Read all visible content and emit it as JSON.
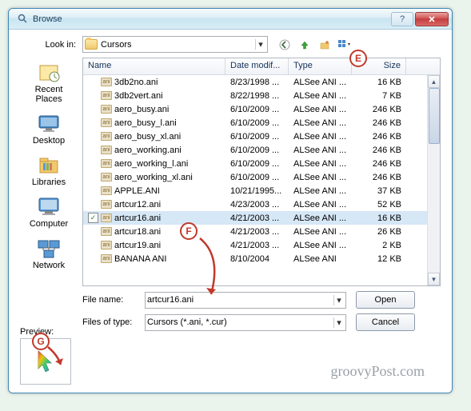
{
  "window": {
    "title": "Browse"
  },
  "lookin": {
    "label": "Look in:",
    "value": "Cursors"
  },
  "toolbar_icons": [
    "back",
    "up",
    "new-folder",
    "view"
  ],
  "columns": {
    "name": "Name",
    "date": "Date modif...",
    "type": "Type",
    "size": "Size"
  },
  "files": [
    {
      "name": "3db2no.ani",
      "date": "8/23/1998 ...",
      "type": "ALSee ANI ...",
      "size": "16 KB",
      "sel": false
    },
    {
      "name": "3db2vert.ani",
      "date": "8/22/1998 ...",
      "type": "ALSee ANI ...",
      "size": "7 KB",
      "sel": false
    },
    {
      "name": "aero_busy.ani",
      "date": "6/10/2009 ...",
      "type": "ALSee ANI ...",
      "size": "246 KB",
      "sel": false
    },
    {
      "name": "aero_busy_l.ani",
      "date": "6/10/2009 ...",
      "type": "ALSee ANI ...",
      "size": "246 KB",
      "sel": false
    },
    {
      "name": "aero_busy_xl.ani",
      "date": "6/10/2009 ...",
      "type": "ALSee ANI ...",
      "size": "246 KB",
      "sel": false
    },
    {
      "name": "aero_working.ani",
      "date": "6/10/2009 ...",
      "type": "ALSee ANI ...",
      "size": "246 KB",
      "sel": false
    },
    {
      "name": "aero_working_l.ani",
      "date": "6/10/2009 ...",
      "type": "ALSee ANI ...",
      "size": "246 KB",
      "sel": false
    },
    {
      "name": "aero_working_xl.ani",
      "date": "6/10/2009 ...",
      "type": "ALSee ANI ...",
      "size": "246 KB",
      "sel": false
    },
    {
      "name": "APPLE.ANI",
      "date": "10/21/1995...",
      "type": "ALSee ANI ...",
      "size": "37 KB",
      "sel": false
    },
    {
      "name": "artcur12.ani",
      "date": "4/23/2003 ...",
      "type": "ALSee ANI ...",
      "size": "52 KB",
      "sel": false
    },
    {
      "name": "artcur16.ani",
      "date": "4/21/2003 ...",
      "type": "ALSee ANI ...",
      "size": "16 KB",
      "sel": true
    },
    {
      "name": "artcur18.ani",
      "date": "4/21/2003 ...",
      "type": "ALSee ANI ...",
      "size": "26 KB",
      "sel": false
    },
    {
      "name": "artcur19.ani",
      "date": "4/21/2003 ...",
      "type": "ALSee ANI ...",
      "size": "2 KB",
      "sel": false
    },
    {
      "name": "BANANA ANI",
      "date": "8/10/2004",
      "type": "ALSee ANI",
      "size": "12 KB",
      "sel": false
    }
  ],
  "places": [
    {
      "label": "Recent Places",
      "kind": "recent"
    },
    {
      "label": "Desktop",
      "kind": "desktop"
    },
    {
      "label": "Libraries",
      "kind": "libraries"
    },
    {
      "label": "Computer",
      "kind": "computer"
    },
    {
      "label": "Network",
      "kind": "network"
    }
  ],
  "filename": {
    "label": "File name:",
    "value": "artcur16.ani"
  },
  "filetype": {
    "label": "Files of type:",
    "value": "Cursors (*.ani, *.cur)"
  },
  "buttons": {
    "open": "Open",
    "cancel": "Cancel"
  },
  "preview": {
    "label": "Preview:"
  },
  "callouts": {
    "e": "E",
    "f": "F",
    "g": "G"
  },
  "brand": "groovyPost.com"
}
